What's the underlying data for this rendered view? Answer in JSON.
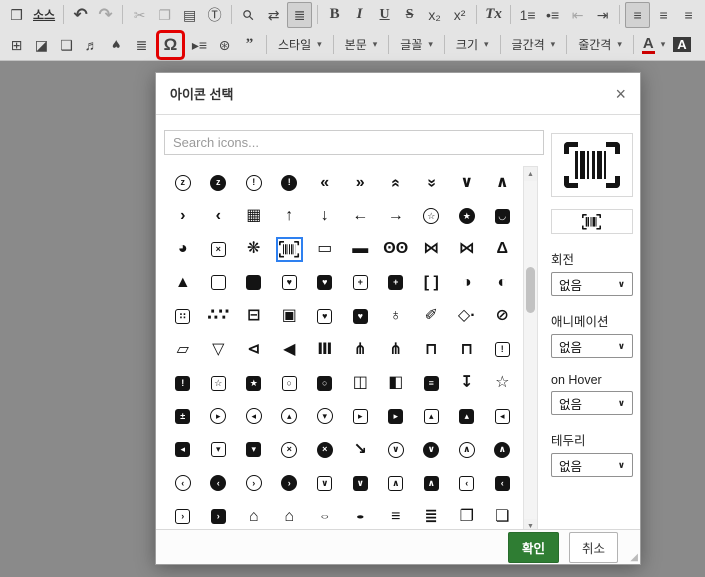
{
  "toolbar": {
    "caret": "▾",
    "row1": [
      {
        "k": "btn",
        "n": "source-icon-button",
        "g": "❒"
      },
      {
        "k": "btn",
        "n": "source-text-button",
        "t": "소스",
        "cls": "txt"
      },
      {
        "k": "sep"
      },
      {
        "k": "btn",
        "n": "undo-button",
        "g": "↶",
        "cls": "big"
      },
      {
        "k": "btn",
        "n": "redo-button",
        "g": "↷",
        "cls": "big",
        "dis": 1
      },
      {
        "k": "sep"
      },
      {
        "k": "btn",
        "n": "cut-button",
        "g": "✂",
        "dis": 1
      },
      {
        "k": "btn",
        "n": "copy-button",
        "g": "❐",
        "dis": 1
      },
      {
        "k": "btn",
        "n": "paste-button",
        "g": "▤"
      },
      {
        "k": "btn",
        "n": "paste-text-button",
        "g": "Ⓣ"
      },
      {
        "k": "sep"
      },
      {
        "k": "btn",
        "n": "find-button",
        "g": "⚲",
        "r": -45
      },
      {
        "k": "btn",
        "n": "replace-button",
        "g": "⇄"
      },
      {
        "k": "btn",
        "n": "select-all-button",
        "g": "≣",
        "on": 1
      },
      {
        "k": "sep"
      },
      {
        "k": "btn",
        "n": "bold-button",
        "g": "B",
        "cls": "fb"
      },
      {
        "k": "btn",
        "n": "italic-button",
        "g": "I",
        "cls": "fi"
      },
      {
        "k": "btn",
        "n": "underline-button",
        "g": "U",
        "cls": "fu"
      },
      {
        "k": "btn",
        "n": "strikethrough-button",
        "g": "S",
        "cls": "fs"
      },
      {
        "k": "btn",
        "n": "subscript-button",
        "g": "x₂"
      },
      {
        "k": "btn",
        "n": "superscript-button",
        "g": "x²"
      },
      {
        "k": "sep"
      },
      {
        "k": "btn",
        "n": "remove-format-button",
        "g": "Tx",
        "cls": "fi"
      },
      {
        "k": "sep"
      },
      {
        "k": "btn",
        "n": "numbered-list-button",
        "g": "1≡"
      },
      {
        "k": "btn",
        "n": "bulleted-list-button",
        "g": "•≡"
      },
      {
        "k": "btn",
        "n": "outdent-button",
        "g": "⇤",
        "dis": 1
      },
      {
        "k": "btn",
        "n": "indent-button",
        "g": "⇥"
      },
      {
        "k": "sep"
      },
      {
        "k": "btn",
        "n": "align-left-button",
        "g": "≡",
        "on": 1
      },
      {
        "k": "btn",
        "n": "align-center-button",
        "g": "≡"
      },
      {
        "k": "btn",
        "n": "align-right-button",
        "g": "≡"
      },
      {
        "k": "btn",
        "n": "justify-button",
        "g": "≡"
      }
    ],
    "row2": [
      {
        "k": "btn",
        "n": "table-button",
        "g": "⊞"
      },
      {
        "k": "btn",
        "n": "image-button",
        "g": "◪"
      },
      {
        "k": "btn",
        "n": "gallery-button",
        "g": "❑"
      },
      {
        "k": "btn",
        "n": "media-button",
        "g": "♬"
      },
      {
        "k": "btn",
        "n": "map-pin-button",
        "g": "♥",
        "r": 180
      },
      {
        "k": "btn",
        "n": "horizontal-lines-button",
        "g": "≣"
      },
      {
        "k": "btn",
        "n": "special-char-button",
        "g": "Ω",
        "cls": "big",
        "red": 1
      },
      {
        "k": "btn",
        "n": "page-break-button",
        "g": "▸≡"
      },
      {
        "k": "btn",
        "n": "globe-button",
        "g": "⊛"
      },
      {
        "k": "btn",
        "n": "quote-button",
        "g": "”",
        "cls": "fb big"
      },
      {
        "k": "sep"
      },
      {
        "k": "dd",
        "n": "style-dropdown",
        "t": "스타일"
      },
      {
        "k": "sep"
      },
      {
        "k": "dd",
        "n": "format-dropdown",
        "t": "본문"
      },
      {
        "k": "sep"
      },
      {
        "k": "dd",
        "n": "font-dropdown",
        "t": "글꼴"
      },
      {
        "k": "sep"
      },
      {
        "k": "dd",
        "n": "size-dropdown",
        "t": "크기"
      },
      {
        "k": "sep"
      },
      {
        "k": "dd",
        "n": "letter-spacing-dropdown",
        "t": "글간격"
      },
      {
        "k": "sep"
      },
      {
        "k": "dd",
        "n": "line-spacing-dropdown",
        "t": "줄간격"
      },
      {
        "k": "sep"
      },
      {
        "k": "btn",
        "n": "text-color-button",
        "g": "A",
        "cls": "tcolor",
        "caret": 1
      },
      {
        "k": "btn",
        "n": "bg-color-button",
        "g": "A",
        "cls": "bgcolor"
      }
    ]
  },
  "dialog": {
    "title": "아이콘 선택",
    "close_icon": "×",
    "search": {
      "placeholder": "Search icons..."
    },
    "scrollbar": {
      "up_icon": "▲",
      "down_icon": "▼"
    },
    "resize_icon": "◢",
    "select_caret": "∨",
    "selected_icon": "barcode-read",
    "colors": {
      "confirm_bg": "#2f7d33",
      "selected_border": "#2e80f0",
      "annotation_red": "#e30000"
    },
    "fields": [
      {
        "name": "rotation-select",
        "label": "회전",
        "value": "없음"
      },
      {
        "name": "animation-select",
        "label": "애니메이션",
        "value": "없음"
      },
      {
        "name": "hover-select",
        "label": "on Hover",
        "value": "없음"
      },
      {
        "name": "border-select",
        "label": "테두리",
        "value": "없음"
      }
    ],
    "footer": {
      "confirm": "확인",
      "cancel": "취소"
    },
    "grid": {
      "icons": [
        {
          "n": "alarm-snooze",
          "g": "z",
          "s": "co"
        },
        {
          "n": "alarm-snooze-solid",
          "g": "z",
          "s": "cs"
        },
        {
          "n": "alarm-exclamation",
          "g": "!",
          "s": "co"
        },
        {
          "n": "alarm-exclamation-solid",
          "g": "!",
          "s": "cs"
        },
        {
          "n": "angles-left",
          "g": "«"
        },
        {
          "n": "angles-right",
          "g": "»"
        },
        {
          "n": "angles-up",
          "g": "»",
          "r": -90
        },
        {
          "n": "angles-down",
          "g": "»",
          "r": 90
        },
        {
          "n": "angle-down",
          "g": "∨"
        },
        {
          "n": "angle-up",
          "g": "∧"
        },
        {
          "n": "angle-right",
          "g": "›"
        },
        {
          "n": "angle-left",
          "g": "‹"
        },
        {
          "n": "cash-register",
          "g": "▦"
        },
        {
          "n": "arrow-up",
          "g": "↑"
        },
        {
          "n": "arrow-down",
          "g": "↓"
        },
        {
          "n": "arrow-left",
          "g": "←"
        },
        {
          "n": "arrow-right",
          "g": "→"
        },
        {
          "n": "award",
          "g": "☆",
          "s": "co"
        },
        {
          "n": "award-solid",
          "g": "★",
          "s": "cs"
        },
        {
          "n": "bag-shopping-solid",
          "g": "◡",
          "s": "ss"
        },
        {
          "n": "basketball-solid",
          "g": "◕"
        },
        {
          "n": "clipboard-xmark",
          "g": "×",
          "s": "so"
        },
        {
          "n": "basketball",
          "g": "❋"
        },
        {
          "n": "barcode-read",
          "bc": 1,
          "sel": 1
        },
        {
          "n": "bed",
          "g": "▭"
        },
        {
          "n": "bed-solid",
          "g": "▬"
        },
        {
          "n": "binoculars",
          "g": "ʘʘ"
        },
        {
          "n": "bone",
          "g": "⋈"
        },
        {
          "n": "bone-solid",
          "g": "⋈",
          "b": 1
        },
        {
          "n": "flask",
          "g": "Δ"
        },
        {
          "n": "flask-solid",
          "g": "▲"
        },
        {
          "n": "book",
          "g": "",
          "s": "so"
        },
        {
          "n": "book-solid",
          "g": "",
          "s": "ss"
        },
        {
          "n": "book-heart",
          "g": "♥",
          "s": "so"
        },
        {
          "n": "book-heart-solid",
          "g": "♥",
          "s": "ss"
        },
        {
          "n": "book-medical",
          "g": "+",
          "s": "so"
        },
        {
          "n": "book-medical-solid",
          "g": "+",
          "s": "ss"
        },
        {
          "n": "brackets",
          "g": "[ ]"
        },
        {
          "n": "circle-half",
          "g": "◑"
        },
        {
          "n": "circle-half-solid",
          "g": "◐"
        },
        {
          "n": "braille",
          "g": "∷",
          "s": "so"
        },
        {
          "n": "braille-dots",
          "g": "∴∵"
        },
        {
          "n": "browser",
          "g": "⊟"
        },
        {
          "n": "browser-solid",
          "g": "▣"
        },
        {
          "n": "calendar-heart",
          "g": "♥",
          "s": "so"
        },
        {
          "n": "calendar-heart-solid",
          "g": "♥",
          "s": "ss"
        },
        {
          "n": "wine-glass",
          "g": "♁"
        },
        {
          "n": "pen-clip",
          "g": "✐"
        },
        {
          "n": "pen-nib",
          "g": "◇·"
        },
        {
          "n": "capsule",
          "g": "⊘"
        },
        {
          "n": "eraser",
          "g": "▱"
        },
        {
          "n": "martini-glass",
          "g": "▽"
        },
        {
          "n": "camera-cctv",
          "g": "⊲"
        },
        {
          "n": "camera-cctv-solid",
          "g": "◀"
        },
        {
          "n": "bench",
          "g": "Ⅲ"
        },
        {
          "n": "share-nodes",
          "g": "⋔"
        },
        {
          "n": "share-nodes-solid",
          "g": "⋔",
          "b": 1
        },
        {
          "n": "network",
          "g": "⊓"
        },
        {
          "n": "network-solid",
          "g": "⊓",
          "b": 1
        },
        {
          "n": "calendar-exclamation",
          "g": "!",
          "s": "so"
        },
        {
          "n": "calendar-exclamation-solid",
          "g": "!",
          "s": "ss"
        },
        {
          "n": "calendar-star",
          "g": "☆",
          "s": "so"
        },
        {
          "n": "calendar-star-solid",
          "g": "★",
          "s": "ss"
        },
        {
          "n": "webcam",
          "g": "○",
          "s": "so"
        },
        {
          "n": "webcam-solid",
          "g": "○",
          "s": "ss"
        },
        {
          "n": "video-camera",
          "g": "◫"
        },
        {
          "n": "video-camera-solid",
          "g": "◧"
        },
        {
          "n": "backpack-solid",
          "g": "≡",
          "s": "ss"
        },
        {
          "n": "cart-arrow-down",
          "g": "↧"
        },
        {
          "n": "cart-star",
          "g": "☆"
        },
        {
          "n": "car-battery-solid",
          "g": "±",
          "s": "ss"
        },
        {
          "n": "circle-caret-right",
          "g": "▸",
          "s": "co"
        },
        {
          "n": "circle-caret-left",
          "g": "◂",
          "s": "co"
        },
        {
          "n": "circle-caret-up",
          "g": "▴",
          "s": "co"
        },
        {
          "n": "circle-caret-down",
          "g": "▾",
          "s": "co"
        },
        {
          "n": "square-caret-right",
          "g": "▸",
          "s": "so"
        },
        {
          "n": "square-caret-right-solid",
          "g": "▸",
          "s": "ss"
        },
        {
          "n": "square-caret-up",
          "g": "▴",
          "s": "so"
        },
        {
          "n": "square-caret-up-solid",
          "g": "▴",
          "s": "ss"
        },
        {
          "n": "square-caret-left",
          "g": "◂",
          "s": "so"
        },
        {
          "n": "square-caret-left-solid",
          "g": "◂",
          "s": "ss"
        },
        {
          "n": "square-caret-down",
          "g": "▾",
          "s": "so"
        },
        {
          "n": "square-caret-down-solid",
          "g": "▾",
          "s": "ss"
        },
        {
          "n": "shield-xmark",
          "g": "×",
          "s": "co"
        },
        {
          "n": "shield-xmark-solid",
          "g": "×",
          "s": "cs"
        },
        {
          "n": "chart-line-down",
          "g": "↘"
        },
        {
          "n": "circle-chevron-down",
          "g": "∨",
          "s": "co"
        },
        {
          "n": "circle-chevron-down-solid",
          "g": "∨",
          "s": "cs"
        },
        {
          "n": "circle-chevron-up",
          "g": "∧",
          "s": "co"
        },
        {
          "n": "circle-chevron-up-solid",
          "g": "∧",
          "s": "cs"
        },
        {
          "n": "circle-chevron-left",
          "g": "‹",
          "s": "co"
        },
        {
          "n": "circle-chevron-left-solid",
          "g": "‹",
          "s": "cs"
        },
        {
          "n": "circle-chevron-right",
          "g": "›",
          "s": "co"
        },
        {
          "n": "circle-chevron-right-solid",
          "g": "›",
          "s": "cs"
        },
        {
          "n": "square-chevron-down",
          "g": "∨",
          "s": "so"
        },
        {
          "n": "square-chevron-down-solid",
          "g": "∨",
          "s": "ss"
        },
        {
          "n": "square-chevron-up",
          "g": "∧",
          "s": "so"
        },
        {
          "n": "square-chevron-up-solid",
          "g": "∧",
          "s": "ss"
        },
        {
          "n": "square-chevron-left",
          "g": "‹",
          "s": "so"
        },
        {
          "n": "square-chevron-left-solid",
          "g": "‹",
          "s": "ss"
        },
        {
          "n": "square-chevron-right",
          "g": "›",
          "s": "so"
        },
        {
          "n": "square-chevron-right-solid",
          "g": "›",
          "s": "ss"
        },
        {
          "n": "church",
          "g": "⌂"
        },
        {
          "n": "church-solid",
          "g": "⌂",
          "b": 1
        },
        {
          "n": "coin",
          "g": "○",
          "sq": 1
        },
        {
          "n": "coin-solid",
          "g": "●",
          "sq": 1
        },
        {
          "n": "coins",
          "g": "≡"
        },
        {
          "n": "coins-solid",
          "g": "≣"
        },
        {
          "n": "clone-solid",
          "g": "❐"
        },
        {
          "n": "clone",
          "g": "❏"
        }
      ]
    }
  }
}
